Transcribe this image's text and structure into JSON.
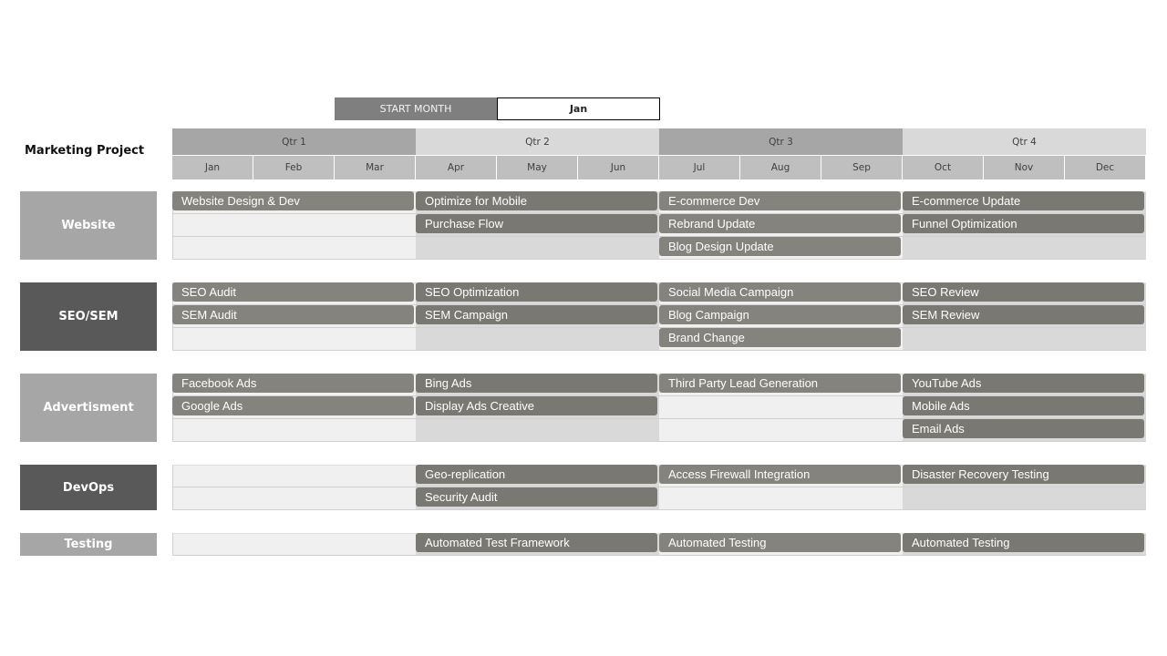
{
  "start_month": {
    "label": "START MONTH",
    "value": "Jan"
  },
  "project_title": "Marketing Project",
  "quarters": [
    "Qtr 1",
    "Qtr 2",
    "Qtr 3",
    "Qtr 4"
  ],
  "months": [
    "Jan",
    "Feb",
    "Mar",
    "Apr",
    "May",
    "Jun",
    "Jul",
    "Aug",
    "Sep",
    "Oct",
    "Nov",
    "Dec"
  ],
  "colors": {
    "category_light": "#a6a6a6",
    "category_dark": "#595959",
    "bar": "#85837d",
    "cell_light": "#f0f0f0",
    "cell_dark": "#d9d9d9"
  },
  "categories": [
    {
      "name": "Website",
      "style": "light",
      "rows": 3,
      "quarters": [
        [
          "Website Design & Dev"
        ],
        [
          "Optimize for Mobile",
          "Purchase Flow"
        ],
        [
          "E-commerce Dev",
          "Rebrand Update",
          "Blog Design Update"
        ],
        [
          "E-commerce Update",
          "Funnel Optimization"
        ]
      ]
    },
    {
      "name": "SEO/SEM",
      "style": "dark",
      "rows": 3,
      "quarters": [
        [
          "SEO Audit",
          "SEM Audit"
        ],
        [
          "SEO Optimization",
          "SEM Campaign"
        ],
        [
          "Social Media Campaign",
          "Blog Campaign",
          "Brand Change"
        ],
        [
          "SEO Review",
          "SEM Review"
        ]
      ]
    },
    {
      "name": "Advertisment",
      "style": "light",
      "rows": 3,
      "quarters": [
        [
          "Facebook Ads",
          "Google Ads"
        ],
        [
          "Bing Ads",
          "Display Ads Creative"
        ],
        [
          "Third Party Lead Generation"
        ],
        [
          "YouTube Ads",
          "Mobile Ads",
          "Email Ads"
        ]
      ]
    },
    {
      "name": "DevOps",
      "style": "dark",
      "rows": 2,
      "quarters": [
        [],
        [
          "Geo-replication",
          "Security Audit"
        ],
        [
          "Access Firewall Integration"
        ],
        [
          "Disaster Recovery Testing"
        ]
      ]
    },
    {
      "name": "Testing",
      "style": "light",
      "rows": 1,
      "quarters": [
        [],
        [
          "Automated Test Framework"
        ],
        [
          "Automated Testing"
        ],
        [
          "Automated Testing"
        ]
      ]
    }
  ]
}
